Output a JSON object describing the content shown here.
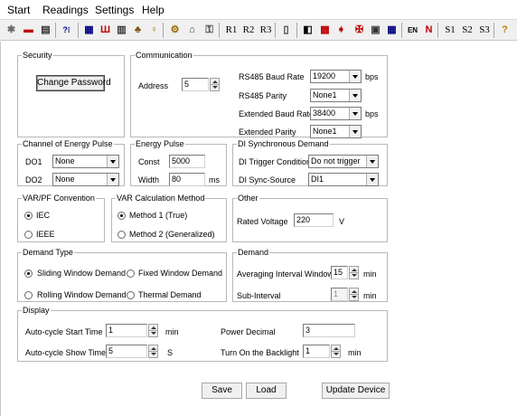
{
  "menu": [
    "Start",
    "Readings",
    "Settings",
    "Help"
  ],
  "toolbar": {
    "icons": [
      "tool-icon",
      "device-icon",
      "meter-icon",
      "help-icon",
      "bar-chart-icon",
      "energy-icon",
      "table-icon",
      "tree-icon",
      "bulb-icon",
      "gear-icon",
      "house-icon",
      "lock-icon"
    ],
    "relay_labels": [
      "R1",
      "R2",
      "R3"
    ],
    "icons2": [
      "document-icon",
      "save-icon",
      "chart-icon",
      "export-icon",
      "alarm-icon",
      "database-icon",
      "grid-icon"
    ],
    "label_en": "EN",
    "label_n": "N",
    "sample_labels": [
      "S1",
      "S2",
      "S3"
    ],
    "help_icon": "question-icon"
  },
  "security": {
    "legend": "Security",
    "change_password": "Change Password"
  },
  "communication": {
    "legend": "Communication",
    "address_label": "Address",
    "address_value": "5",
    "rs485_baud_label": "RS485 Baud Rate",
    "rs485_baud_value": "19200",
    "bps1": "bps",
    "rs485_parity_label": "RS485 Parity",
    "rs485_parity_value": "None1",
    "ext_baud_label": "Extended Baud Rate",
    "ext_baud_value": "38400",
    "bps2": "bps",
    "ext_parity_label": "Extended Parity",
    "ext_parity_value": "None1"
  },
  "channel_energy_pulse": {
    "legend": "Channel of Energy Pulse",
    "do1_label": "DO1",
    "do1_value": "None",
    "do2_label": "DO2",
    "do2_value": "None"
  },
  "energy_pulse": {
    "legend": "Energy Pulse",
    "const_label": "Const",
    "const_value": "5000",
    "width_label": "Width",
    "width_value": "80",
    "width_unit": "ms"
  },
  "di_sync": {
    "legend": "DI Synchronous Demand",
    "trigger_label": "DI Trigger Condition",
    "trigger_value": "Do not trigger",
    "source_label": "DI Sync-Source",
    "source_value": "DI1"
  },
  "var_pf": {
    "legend": "VAR/PF Convention",
    "opt_iec": "IEC",
    "opt_ieee": "IEEE",
    "selected": "IEC"
  },
  "var_calc": {
    "legend": "VAR Calculation Method",
    "opt1": "Method 1 (True)",
    "opt2": "Method 2 (Generalized)",
    "selected": "Method 1 (True)"
  },
  "other": {
    "legend": "Other",
    "rated_voltage_label": "Rated Voltage",
    "rated_voltage_value": "220",
    "rated_voltage_unit": "V"
  },
  "demand_type": {
    "legend": "Demand Type",
    "opt_sliding": "Sliding Window Demand",
    "opt_fixed": "Fixed Window Demand",
    "opt_rolling": "Rolling Window Demand",
    "opt_thermal": "Thermal Demand",
    "selected": "Sliding Window Demand"
  },
  "demand": {
    "legend": "Demand",
    "avg_interval_label": "Averaging Interval Window",
    "avg_interval_value": "15",
    "avg_interval_unit": "min",
    "sub_interval_label": "Sub-Interval",
    "sub_interval_value": "1",
    "sub_interval_unit": "min"
  },
  "display": {
    "legend": "Display",
    "autocycle_start_label": "Auto-cycle Start Time",
    "autocycle_start_value": "1",
    "autocycle_start_unit": "min",
    "autocycle_show_label": "Auto-cycle Show Time",
    "autocycle_show_value": "5",
    "autocycle_show_unit": "S",
    "power_decimal_label": "Power Decimal",
    "power_decimal_value": "3",
    "backlight_label": "Turn On the Backlight",
    "backlight_value": "1",
    "backlight_unit": "min"
  },
  "actions": {
    "save": "Save",
    "load": "Load",
    "update_device": "Update Device"
  }
}
